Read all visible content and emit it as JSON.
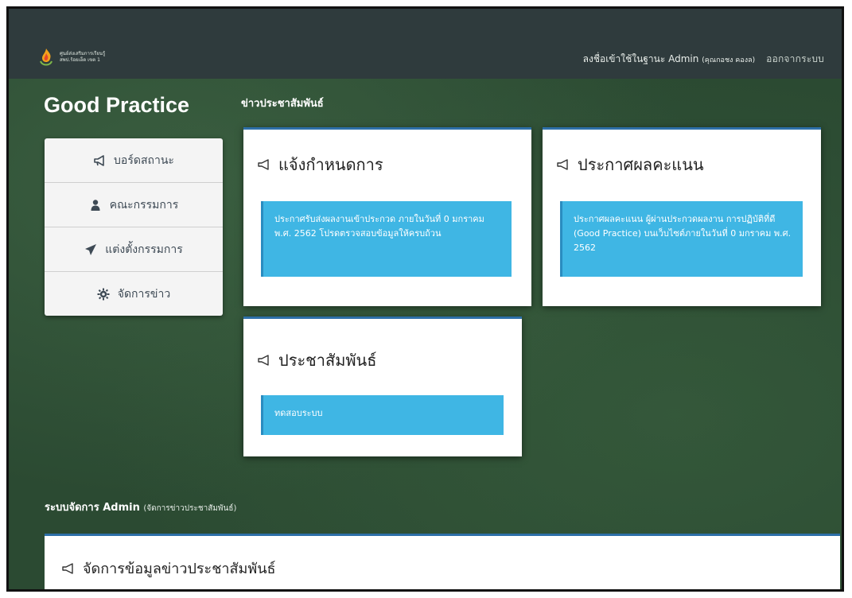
{
  "topbar": {
    "logo_line1": "ศูนย์ส่งเสริมการเรียนรู้",
    "logo_line2": "สพป.ร้อยเอ็ด เขต 1",
    "login_as": "ลงชื่อเข้าใช้ในฐานะ Admin",
    "user_name": "(คุณกอชง คองล)",
    "logout": "ออกจากระบบ"
  },
  "brand": "Good Practice",
  "section_title": "ข่าวประชาสัมพันธ์",
  "sidebar": {
    "items": [
      {
        "label": "บอร์ดสถานะ",
        "icon": "megaphone-icon"
      },
      {
        "label": "คณะกรรมการ",
        "icon": "user-icon"
      },
      {
        "label": "แต่งตั้งกรรมการ",
        "icon": "paper-plane-icon"
      },
      {
        "label": "จัดการข่าว",
        "icon": "gear-icon"
      }
    ]
  },
  "cards": [
    {
      "title": "แจ้งกำหนดการ",
      "body": "ประกาศรับส่งผลงานเข้าประกวด ภายในวันที่ 0 มกราคม พ.ศ. 2562 โปรดตรวจสอบข้อมูลให้ครบถ้วน"
    },
    {
      "title": "ประกาศผลคะแนน",
      "body": "ประกาศผลคะแนน ผู้ผ่านประกวดผลงาน การปฏิบัติที่ดี (Good Practice) บนเว็บไซต์ภายในวันที่ 0 มกราคม พ.ศ. 2562"
    },
    {
      "title": "ประชาสัมพันธ์",
      "body": "ทดสอบระบบ"
    }
  ],
  "admin": {
    "label": "ระบบจัดการ Admin",
    "sublabel": "(จัดการข่าวประชาสัมพันธ์)",
    "card_title": "จัดการข้อมูลข่าวประชาสัมพันธ์"
  },
  "colors": {
    "background": "#2b4a32",
    "topbar": "#2f3b3d",
    "info_box": "#3fb6e4",
    "card_border": "#2d6fa8"
  }
}
